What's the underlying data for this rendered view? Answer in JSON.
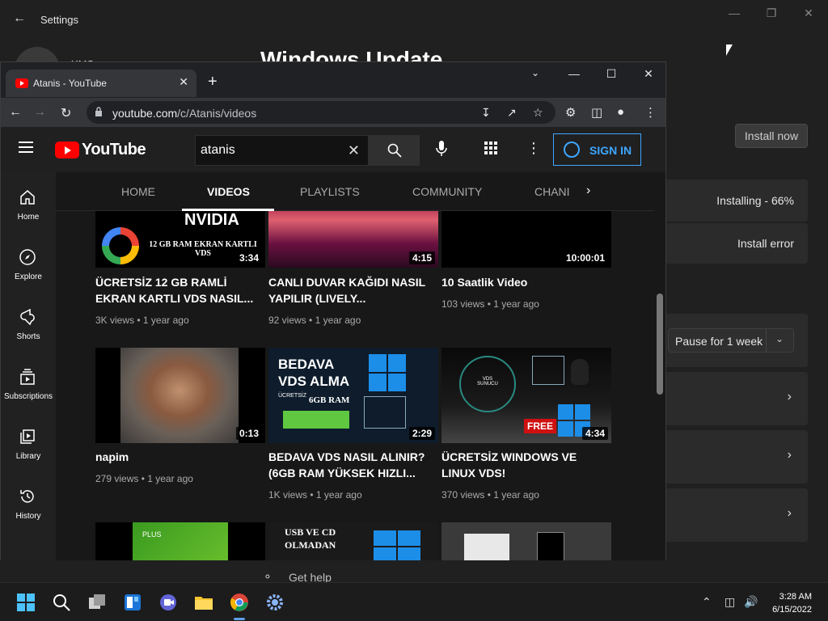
{
  "settings": {
    "title": "Settings",
    "user_name": "XMS",
    "heading": "Windows Update",
    "install_now": "Install now",
    "status_installing": "Installing - 66%",
    "status_error": "Install error",
    "pause_label": "Pause for 1 week",
    "get_help": "Get help"
  },
  "chrome": {
    "tab_title": "Atanis - YouTube",
    "url_host": "youtube.com",
    "url_path": "/c/Atanis/videos"
  },
  "youtube": {
    "logo_text": "YouTube",
    "search_value": "atanis",
    "sign_in": "SIGN IN",
    "guide": [
      {
        "label": "Home",
        "icon": "home-icon"
      },
      {
        "label": "Explore",
        "icon": "compass-icon"
      },
      {
        "label": "Shorts",
        "icon": "shorts-icon"
      },
      {
        "label": "Subscriptions",
        "icon": "subscriptions-icon"
      },
      {
        "label": "Library",
        "icon": "library-icon"
      },
      {
        "label": "History",
        "icon": "history-icon"
      }
    ],
    "tabs": [
      "HOME",
      "VIDEOS",
      "PLAYLISTS",
      "COMMUNITY",
      "CHANI"
    ],
    "active_tab": "VIDEOS",
    "videos": [
      {
        "title": "ÜCRETSİZ 12 GB RAMLİ EKRAN KARTLI VDS NASIL...",
        "views": "3K views",
        "age": "1 year ago",
        "duration": "3:34",
        "thumb_text": "12 GB RAM EKRAN KARTLI VDS",
        "thumb_top_text": "NVIDIA"
      },
      {
        "title": "CANLI DUVAR KAĞIDI NASIL YAPILIR (LIVELY...",
        "views": "92 views",
        "age": "1 year ago",
        "duration": "4:15"
      },
      {
        "title": "10 Saatlik Video",
        "views": "103 views",
        "age": "1 year ago",
        "duration": "10:00:01"
      },
      {
        "title": "napim",
        "views": "279 views",
        "age": "1 year ago",
        "duration": "0:13"
      },
      {
        "title": "BEDAVA VDS NASIL ALINIR? (6GB RAM YÜKSEK HIZLI...",
        "views": "1K views",
        "age": "1 year ago",
        "duration": "2:29",
        "thumb_text": "BEDAVA VDS ALMA",
        "thumb_sub": "6GB RAM",
        "thumb_small": "ÜCRETSİZ"
      },
      {
        "title": "ÜCRETSİZ WINDOWS VE LINUX VDS!",
        "views": "370 views",
        "age": "1 year ago",
        "duration": "4:34",
        "thumb_text": "FREE",
        "thumb_circle": "VDS SUNUCU"
      },
      {
        "title": "",
        "views": "",
        "age": "",
        "duration": "",
        "thumb_text": "PLUS"
      },
      {
        "title": "",
        "views": "",
        "age": "",
        "duration": "",
        "thumb_text": "USB VE CD OLMADAN"
      },
      {
        "title": "",
        "views": "",
        "age": "",
        "duration": ""
      }
    ]
  },
  "taskbar": {
    "time": "3:28 AM",
    "date": "6/15/2022"
  },
  "colors": {
    "yt_red": "#ff0000",
    "signin_blue": "#3ea6ff",
    "settings_bg": "#202020"
  }
}
